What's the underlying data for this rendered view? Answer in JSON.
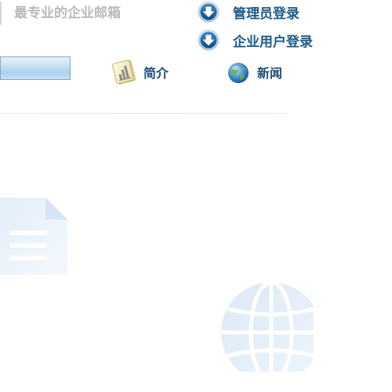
{
  "header": {
    "slogan": "最专业的企业邮箱"
  },
  "login": {
    "admin_label": "管理员登录",
    "user_label": "企业用户登录",
    "icon": "download-arrow-circle-icon"
  },
  "nav": {
    "items": [
      {
        "label": "简介",
        "icon": "chart-document-icon"
      },
      {
        "label": "新闻",
        "icon": "globe-icon"
      }
    ]
  },
  "background": {
    "icons": [
      "document-watermark-icon",
      "globe-watermark-icon"
    ]
  },
  "colors": {
    "link_text": "#1e5a8a",
    "slogan_text": "#b9b9b9",
    "icon_blue": "#2d6fa8"
  }
}
